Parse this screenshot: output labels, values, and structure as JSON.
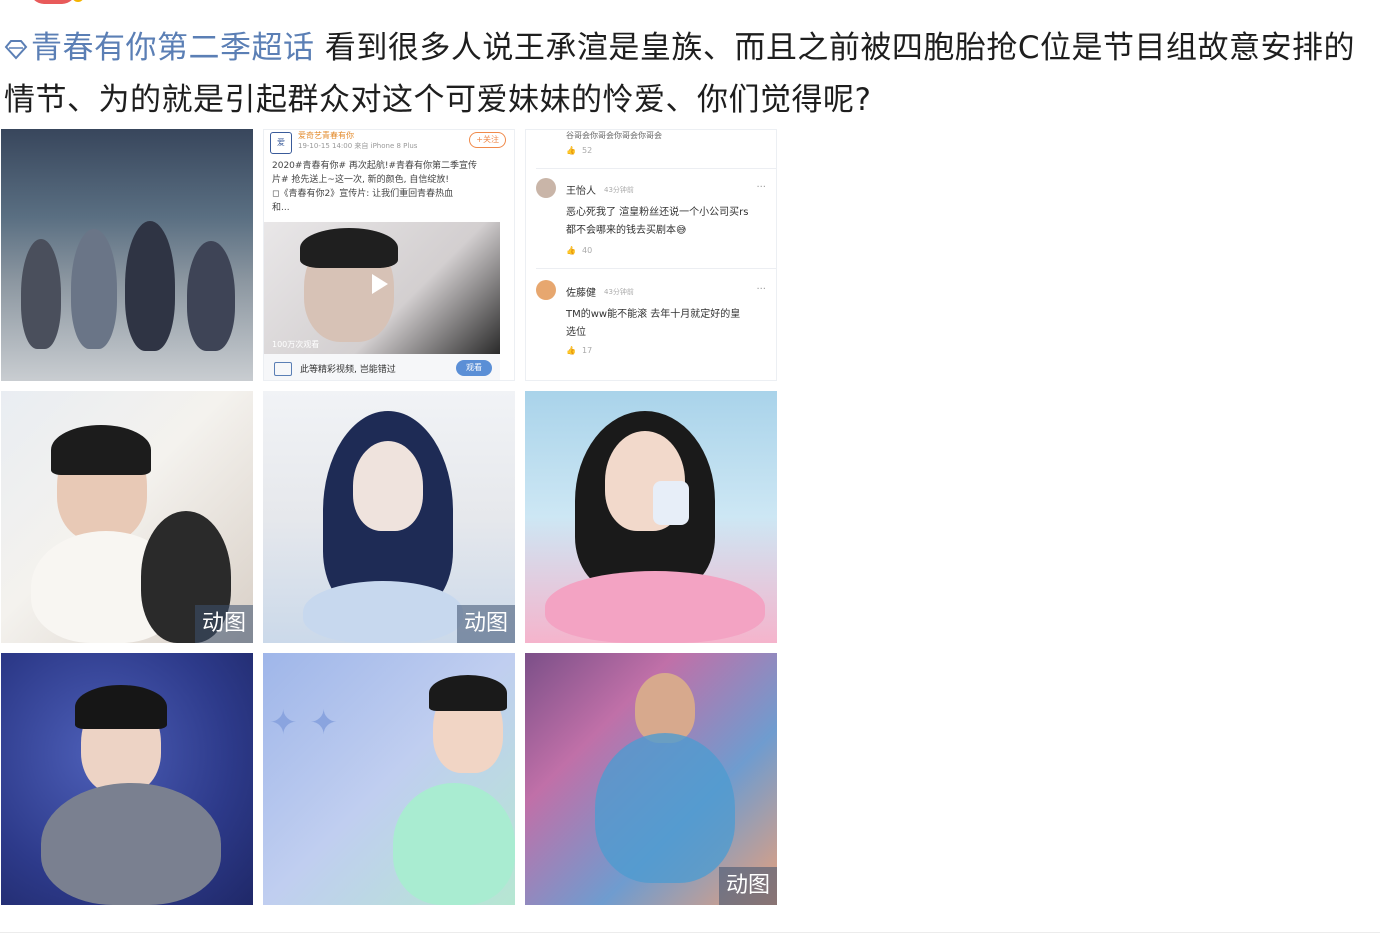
{
  "post": {
    "topic": "青春有你第二季超话",
    "body": " 看到很多人说王承渲是皇族、而且之前被四胞胎抢C位是节目组故意安排的情节、为的就是引起群众对这个可爱妹妹的怜爱、你们觉得呢?"
  },
  "colors": {
    "topic": "#5b7fb5",
    "text": "#1e1e1e",
    "badge_bg": "rgba(60,80,110,0.55)"
  },
  "gif_badge": "动图",
  "screenshot_left": {
    "account": "爱奇艺青春有你",
    "meta": "19-10-15 14:00 来自 iPhone 8 Plus",
    "follow": "+关注",
    "text_line1": "2020#青春有你# 再次起航!#青春有你第二季宣传",
    "text_line2": "片# 抢先送上~这一次, 新的颜色, 自信绽放!",
    "text_line3": "◻《青春有你2》宣传片: 让我们重回青春热血",
    "text_line4": "和...",
    "views": "100万次观看",
    "footer_text": "此等精彩视频, 岂能错过",
    "watch": "观看"
  },
  "screenshot_right": {
    "top_line": "谷哥会你哥会你哥会你哥会",
    "top_likes": "52",
    "comments": [
      {
        "name": "王怡人",
        "time": "43分钟前",
        "body_line1": "恶心死我了 渲皇粉丝还说一个小公司买rs",
        "body_line2": "都不会哪来的钱去买剧本😅",
        "likes": "40"
      },
      {
        "name": "佐藤健",
        "time": "43分钟前",
        "body_line1": "TM的ww能不能滚 去年十月就定好的皇",
        "body_line2": "选位",
        "likes": "17"
      }
    ]
  },
  "images": [
    {
      "name": "dance-group-photo",
      "gif": false
    },
    {
      "name": "screenshot-weibo-post",
      "gif": false
    },
    {
      "name": "screenshot-comments",
      "gif": false
    },
    {
      "name": "girl-waving-gif",
      "gif": true
    },
    {
      "name": "girl-smiling-gif",
      "gif": true
    },
    {
      "name": "girl-drinking",
      "gif": false
    },
    {
      "name": "girl-dancing-blue",
      "gif": false
    },
    {
      "name": "girl-laughing-banner",
      "gif": false
    },
    {
      "name": "stage-performance-gif",
      "gif": true
    }
  ]
}
